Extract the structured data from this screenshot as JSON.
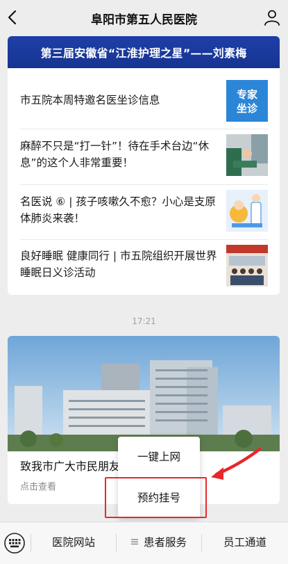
{
  "nav": {
    "title": "阜阳市第五人民医院",
    "back_icon": "chevron-left-icon",
    "profile_icon": "person-icon"
  },
  "banner": {
    "text": "第三届安徽省“江淮护理之星”——刘素梅"
  },
  "articles": [
    {
      "title": "市五院本周特邀名医坐诊信息",
      "thumb_text_1": "专家",
      "thumb_text_2": "坐诊"
    },
    {
      "title": "麻醉不只是“打一针”！待在手术台边“休息”的这个人非常重要！"
    },
    {
      "title": "名医说 ⑥ | 孩子咳嗽久不愈？小心是支原体肺炎来袭！"
    },
    {
      "title": "良好睡眠 健康同行 | 市五院组织开展世界睡眠日义诊活动"
    }
  ],
  "timestamp": "17:21",
  "feature_card": {
    "title": "致我市广大市民朋友",
    "subtitle": "点击查看"
  },
  "popup_menu": {
    "items": [
      "一键上网",
      "预约挂号"
    ]
  },
  "tabbar": {
    "keyboard_icon": "keyboard-icon",
    "tabs": [
      "医院网站",
      "患者服务",
      "员工通道"
    ]
  },
  "colors": {
    "banner_bg": "#1e3fa8",
    "highlight": "#e8272b",
    "background": "#ededed"
  }
}
